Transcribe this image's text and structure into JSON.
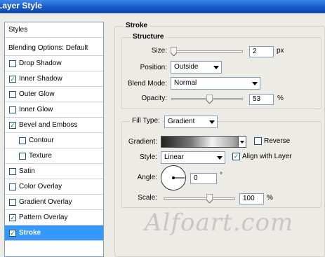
{
  "window": {
    "title": "Layer Style"
  },
  "left_panel": {
    "header": "Styles",
    "blending": "Blending Options: Default",
    "items": [
      {
        "label": "Drop Shadow",
        "checked": false
      },
      {
        "label": "Inner Shadow",
        "checked": true
      },
      {
        "label": "Outer Glow",
        "checked": false
      },
      {
        "label": "Inner Glow",
        "checked": false
      },
      {
        "label": "Bevel and Emboss",
        "checked": true
      },
      {
        "label": "Contour",
        "checked": false
      },
      {
        "label": "Texture",
        "checked": false
      },
      {
        "label": "Satin",
        "checked": false
      },
      {
        "label": "Color Overlay",
        "checked": false
      },
      {
        "label": "Gradient Overlay",
        "checked": false
      },
      {
        "label": "Pattern Overlay",
        "checked": true
      },
      {
        "label": "Stroke",
        "checked": true
      }
    ],
    "check_mark": "✓"
  },
  "stroke": {
    "title": "Stroke",
    "structure": {
      "title": "Structure",
      "size_label": "Size:",
      "size_value": "2",
      "size_unit": "px",
      "position_label": "Position:",
      "position_value": "Outside",
      "blend_label": "Blend Mode:",
      "blend_value": "Normal",
      "opacity_label": "Opacity:",
      "opacity_value": "53",
      "opacity_unit": "%"
    },
    "fill": {
      "fill_type_label": "Fill Type:",
      "fill_type_value": "Gradient",
      "gradient_label": "Gradient:",
      "reverse_label": "Reverse",
      "reverse_checked": false,
      "style_label": "Style:",
      "style_value": "Linear",
      "align_label": "Align with Layer",
      "align_checked": true,
      "angle_label": "Angle:",
      "angle_value": "0",
      "angle_unit": "°",
      "scale_label": "Scale:",
      "scale_value": "100",
      "scale_unit": "%"
    }
  },
  "watermark": "Alfoart.com",
  "colors": {
    "title_bar": "#1658c9",
    "selection": "#3399ff",
    "dialog_bg": "#ecebe6"
  }
}
